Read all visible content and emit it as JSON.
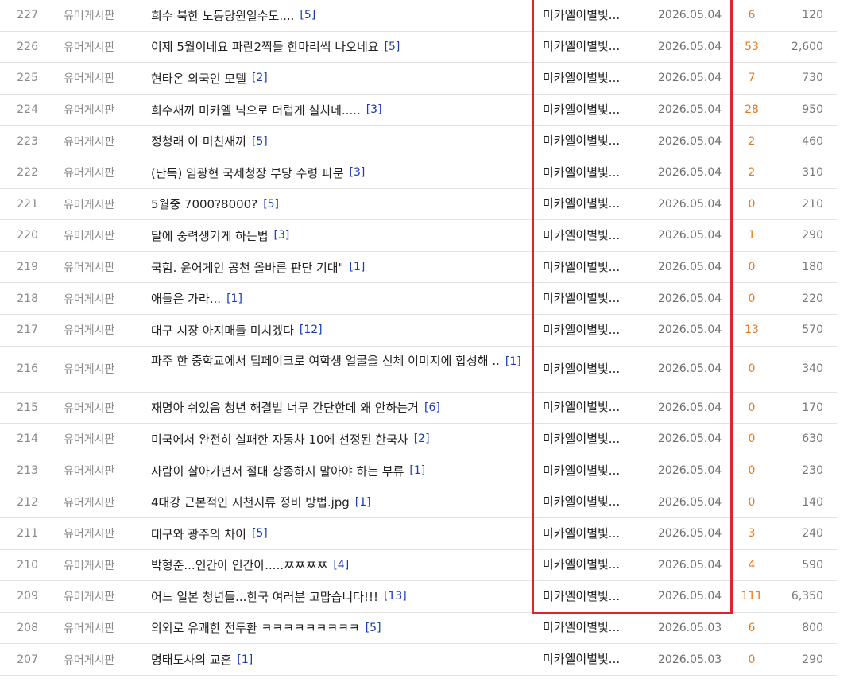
{
  "board": {
    "rows": [
      {
        "num": "227",
        "category": "유머게시판",
        "title": "희수 북한 노동당원일수도....",
        "comments": "[5]",
        "author": "미카엘이별빛...",
        "date": "2026.05.04",
        "recommend": "6",
        "views": "120"
      },
      {
        "num": "226",
        "category": "유머게시판",
        "title": "이제 5월이네요 파란2찍들 한마리씩 나오네요",
        "comments": "[5]",
        "author": "미카엘이별빛...",
        "date": "2026.05.04",
        "recommend": "53",
        "views": "2,600"
      },
      {
        "num": "225",
        "category": "유머게시판",
        "title": "현타온 외국인 모델",
        "comments": "[2]",
        "author": "미카엘이별빛...",
        "date": "2026.05.04",
        "recommend": "7",
        "views": "730"
      },
      {
        "num": "224",
        "category": "유머게시판",
        "title": "희수새끼 미카엘 닉으로 더럽게 설치네.....",
        "comments": "[3]",
        "author": "미카엘이별빛...",
        "date": "2026.05.04",
        "recommend": "28",
        "views": "950"
      },
      {
        "num": "223",
        "category": "유머게시판",
        "title": "정청래 이 미친새끼",
        "comments": "[5]",
        "author": "미카엘이별빛...",
        "date": "2026.05.04",
        "recommend": "2",
        "views": "460"
      },
      {
        "num": "222",
        "category": "유머게시판",
        "title": "(단독) 임광현 국세청장 부당 수령 파문",
        "comments": "[3]",
        "author": "미카엘이별빛...",
        "date": "2026.05.04",
        "recommend": "2",
        "views": "310"
      },
      {
        "num": "221",
        "category": "유머게시판",
        "title": "5월중 7000?8000?",
        "comments": "[5]",
        "author": "미카엘이별빛...",
        "date": "2026.05.04",
        "recommend": "0",
        "views": "210"
      },
      {
        "num": "220",
        "category": "유머게시판",
        "title": "달에 중력생기게 하는법",
        "comments": "[3]",
        "author": "미카엘이별빛...",
        "date": "2026.05.04",
        "recommend": "1",
        "views": "290"
      },
      {
        "num": "219",
        "category": "유머게시판",
        "title": "국힘. 윤어게인 공천 올바른 판단 기대\"",
        "comments": "[1]",
        "author": "미카엘이별빛...",
        "date": "2026.05.04",
        "recommend": "0",
        "views": "180"
      },
      {
        "num": "218",
        "category": "유머게시판",
        "title": "애들은 가라...",
        "comments": "[1]",
        "author": "미카엘이별빛...",
        "date": "2026.05.04",
        "recommend": "0",
        "views": "220"
      },
      {
        "num": "217",
        "category": "유머게시판",
        "title": "대구 시장 아지매들 미치겠다",
        "comments": "[12]",
        "author": "미카엘이별빛...",
        "date": "2026.05.04",
        "recommend": "13",
        "views": "570"
      },
      {
        "num": "216",
        "category": "유머게시판",
        "title": "파주 한 중학교에서 딥페이크로 여학생 얼굴을 신체 이미지에 합성해 ..",
        "comments": "[1]",
        "author": "미카엘이별빛...",
        "date": "2026.05.04",
        "recommend": "0",
        "views": "340"
      },
      {
        "num": "215",
        "category": "유머게시판",
        "title": "재명아 쉬었음 청년 해결법 너무 간단한데 왜 안하는거",
        "comments": "[6]",
        "author": "미카엘이별빛...",
        "date": "2026.05.04",
        "recommend": "0",
        "views": "170"
      },
      {
        "num": "214",
        "category": "유머게시판",
        "title": "미국에서 완전히 실패한 자동차 10에 선정된 한국차",
        "comments": "[2]",
        "author": "미카엘이별빛...",
        "date": "2026.05.04",
        "recommend": "0",
        "views": "630"
      },
      {
        "num": "213",
        "category": "유머게시판",
        "title": "사람이 살아가면서 절대 상종하지 말아야 하는 부류",
        "comments": "[1]",
        "author": "미카엘이별빛...",
        "date": "2026.05.04",
        "recommend": "0",
        "views": "230"
      },
      {
        "num": "212",
        "category": "유머게시판",
        "title": "4대강 근본적인 지천지류 정비 방법.jpg",
        "comments": "[1]",
        "author": "미카엘이별빛...",
        "date": "2026.05.04",
        "recommend": "0",
        "views": "140"
      },
      {
        "num": "211",
        "category": "유머게시판",
        "title": "대구와 광주의 차이",
        "comments": "[5]",
        "author": "미카엘이별빛...",
        "date": "2026.05.04",
        "recommend": "3",
        "views": "240"
      },
      {
        "num": "210",
        "category": "유머게시판",
        "title": "박형준...인간아 인간아.....ㅉㅉㅉㅉ",
        "comments": "[4]",
        "author": "미카엘이별빛...",
        "date": "2026.05.04",
        "recommend": "4",
        "views": "590"
      },
      {
        "num": "209",
        "category": "유머게시판",
        "title": "어느 일본 청년들...한국 여러분 고맙습니다!!!",
        "comments": "[13]",
        "author": "미카엘이별빛...",
        "date": "2026.05.04",
        "recommend": "111",
        "views": "6,350"
      },
      {
        "num": "208",
        "category": "유머게시판",
        "title": "의외로 유쾌한 전두환 ㅋㅋㅋㅋㅋㅋㅋㅋㅋ",
        "comments": "[5]",
        "author": "미카엘이별빛...",
        "date": "2026.05.03",
        "recommend": "6",
        "views": "800"
      },
      {
        "num": "207",
        "category": "유머게시판",
        "title": "명태도사의 교훈",
        "comments": "[1]",
        "author": "미카엘이별빛...",
        "date": "2026.05.03",
        "recommend": "0",
        "views": "290"
      }
    ]
  },
  "colors": {
    "highlight_box": "#e0242f",
    "comment_count": "#1a3bb5",
    "recommend": "#e8791a"
  }
}
